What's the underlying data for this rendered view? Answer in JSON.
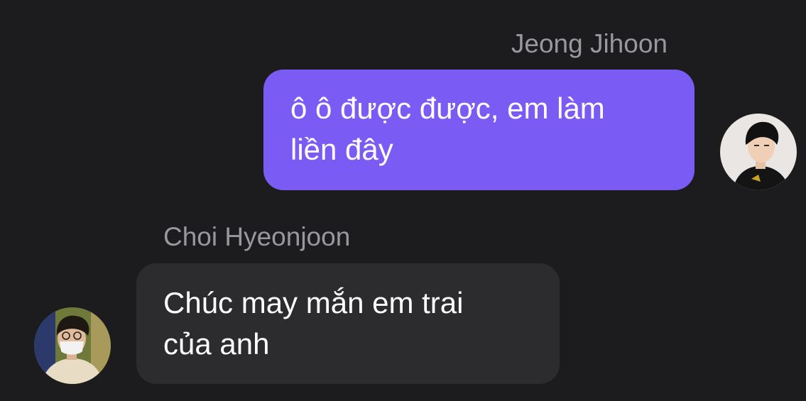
{
  "messages": [
    {
      "sender": "Jeong Jihoon",
      "direction": "outgoing",
      "lines": [
        "ô ô được được, em làm",
        "liền đây"
      ],
      "bubble_color": "#7a5cf5",
      "avatar": "avatar-photo-jeong-jihoon"
    },
    {
      "sender": "Choi Hyeonjoon",
      "direction": "incoming",
      "lines": [
        "Chúc may mắn em trai",
        "của anh"
      ],
      "bubble_color": "#2c2c2e",
      "avatar": "avatar-photo-choi-hyeonjoon"
    }
  ],
  "theme": {
    "background": "#1c1c1e",
    "name_color": "#98989e",
    "text_color": "#ffffff"
  }
}
